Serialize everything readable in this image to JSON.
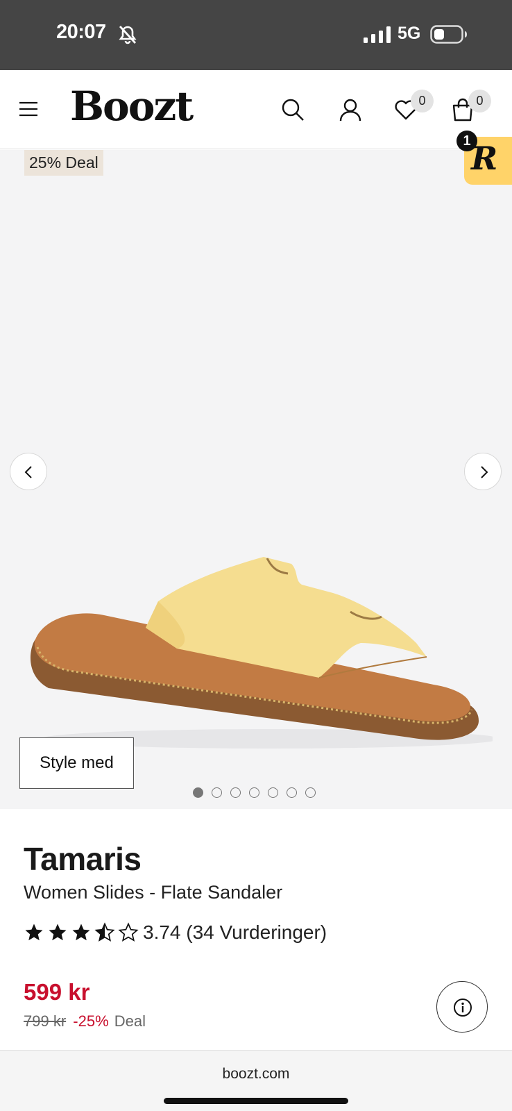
{
  "status_bar": {
    "time": "20:07",
    "network": "5G",
    "icons": [
      "bell-muted-icon",
      "signal-icon",
      "battery-icon"
    ]
  },
  "header": {
    "logo": "Boozt",
    "wishlist_count": "0",
    "cart_count": "0",
    "icons": [
      "menu-icon",
      "search-icon",
      "account-icon",
      "heart-icon",
      "shopping-bag-icon"
    ]
  },
  "floating_widget": {
    "letter": "R",
    "badge": "1",
    "color": "#ffd369"
  },
  "gallery": {
    "deal_tag": "25% Deal",
    "style_button": "Style med",
    "image_count": 7,
    "active_index": 0
  },
  "product": {
    "brand": "Tamaris",
    "name": "Women Slides - Flate Sandaler",
    "rating_value": 3.74,
    "rating_text": "3.74 (34 Vurderinger)",
    "stars": [
      "full",
      "full",
      "full",
      "half",
      "empty"
    ]
  },
  "pricing": {
    "price": "599 kr",
    "old_price": "799 kr",
    "discount": "-25%",
    "deal": "Deal",
    "sale_color": "#c8102e"
  },
  "browser": {
    "url": "boozt.com"
  }
}
